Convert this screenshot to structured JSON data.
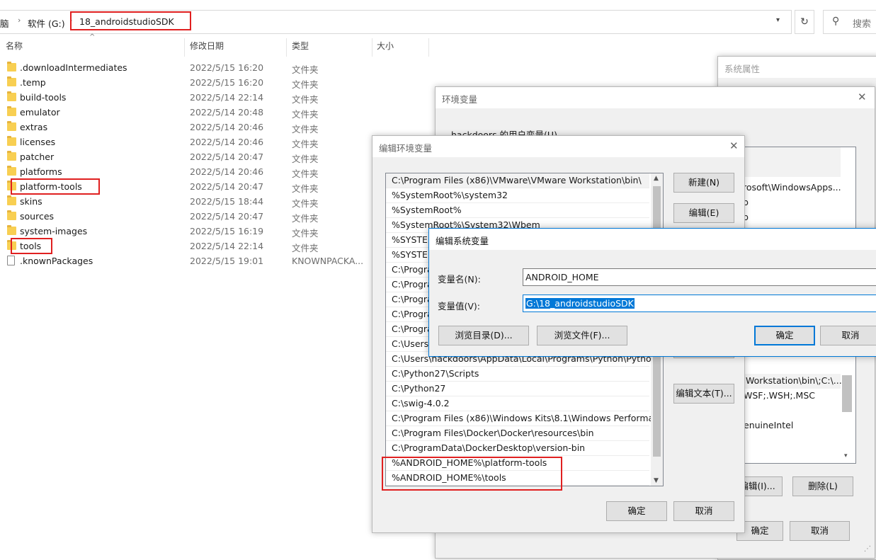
{
  "explorer": {
    "breadcrumb": [
      "脑",
      "软件 (G:)",
      "18_androidstudioSDK"
    ],
    "search_placeholder": "搜索",
    "columns": {
      "name": "名称",
      "date": "修改日期",
      "type": "类型",
      "size": "大小"
    },
    "files": [
      {
        "name": ".downloadIntermediates",
        "date": "2022/5/15 16:20",
        "type": "文件夹",
        "kind": "folder"
      },
      {
        "name": ".temp",
        "date": "2022/5/15 16:20",
        "type": "文件夹",
        "kind": "folder"
      },
      {
        "name": "build-tools",
        "date": "2022/5/14 22:14",
        "type": "文件夹",
        "kind": "folder"
      },
      {
        "name": "emulator",
        "date": "2022/5/14 20:48",
        "type": "文件夹",
        "kind": "folder"
      },
      {
        "name": "extras",
        "date": "2022/5/14 20:46",
        "type": "文件夹",
        "kind": "folder"
      },
      {
        "name": "licenses",
        "date": "2022/5/14 20:46",
        "type": "文件夹",
        "kind": "folder"
      },
      {
        "name": "patcher",
        "date": "2022/5/14 20:47",
        "type": "文件夹",
        "kind": "folder"
      },
      {
        "name": "platforms",
        "date": "2022/5/14 20:46",
        "type": "文件夹",
        "kind": "folder"
      },
      {
        "name": "platform-tools",
        "date": "2022/5/14 20:47",
        "type": "文件夹",
        "kind": "folder",
        "highlight": true
      },
      {
        "name": "skins",
        "date": "2022/5/15 18:44",
        "type": "文件夹",
        "kind": "folder"
      },
      {
        "name": "sources",
        "date": "2022/5/14 20:47",
        "type": "文件夹",
        "kind": "folder"
      },
      {
        "name": "system-images",
        "date": "2022/5/15 16:19",
        "type": "文件夹",
        "kind": "folder"
      },
      {
        "name": "tools",
        "date": "2022/5/14 22:14",
        "type": "文件夹",
        "kind": "folder",
        "highlight": true
      },
      {
        "name": ".knownPackages",
        "date": "2022/5/15 19:01",
        "type": "KNOWNPACKA...",
        "kind": "file"
      }
    ]
  },
  "system_properties": {
    "title": "系统属性"
  },
  "env_dialog": {
    "title": "环境变量",
    "user_group_label": "hackdoors 的用户变量(U)",
    "user_partial": [
      "rosoft\\WindowsApps...",
      "p",
      "p"
    ],
    "system_partial": [
      "Workstation\\bin\\;C:\\...",
      "WSF;.WSH;.MSC",
      "enuineIntel"
    ],
    "edit_button": "编辑(I)...",
    "delete_button": "删除(L)",
    "ok_button": "确定",
    "cancel_button": "取消"
  },
  "edit_env_dialog": {
    "title": "编辑环境变量",
    "entries": [
      "C:\\Program Files (x86)\\VMware\\VMware Workstation\\bin\\",
      "%SystemRoot%\\system32",
      "%SystemRoot%",
      "%SystemRoot%\\System32\\Wbem",
      "%SYSTEM",
      "%SYSTEM",
      "C:\\Progra",
      "C:\\Progra",
      "C:\\Progra",
      "C:\\Progra",
      "C:\\Progra",
      "C:\\Users\\",
      "C:\\Users\\hackdoors\\AppData\\Local\\Programs\\Python\\Pytho...",
      "C:\\Python27\\Scripts",
      "C:\\Python27",
      "C:\\swig-4.0.2",
      "C:\\Program Files (x86)\\Windows Kits\\8.1\\Windows Performa...",
      "C:\\Program Files\\Docker\\Docker\\resources\\bin",
      "C:\\ProgramData\\DockerDesktop\\version-bin",
      "%ANDROID_HOME%\\platform-tools",
      "%ANDROID_HOME%\\tools"
    ],
    "buttons": {
      "new": "新建(N)",
      "edit": "编辑(E)",
      "edit_text": "编辑文本(T)...",
      "ok": "确定",
      "cancel": "取消"
    }
  },
  "edit_sys_var_dialog": {
    "title": "编辑系统变量",
    "name_label": "变量名(N):",
    "name_value": "ANDROID_HOME",
    "value_label": "变量值(V):",
    "value_value": "G:\\18_androidstudioSDK",
    "browse_dir": "浏览目录(D)...",
    "browse_file": "浏览文件(F)...",
    "ok": "确定",
    "cancel": "取消"
  },
  "colors": {
    "highlight_red": "#e02020",
    "accent_blue": "#0078d7",
    "folder_yellow": "#f8cf52"
  }
}
